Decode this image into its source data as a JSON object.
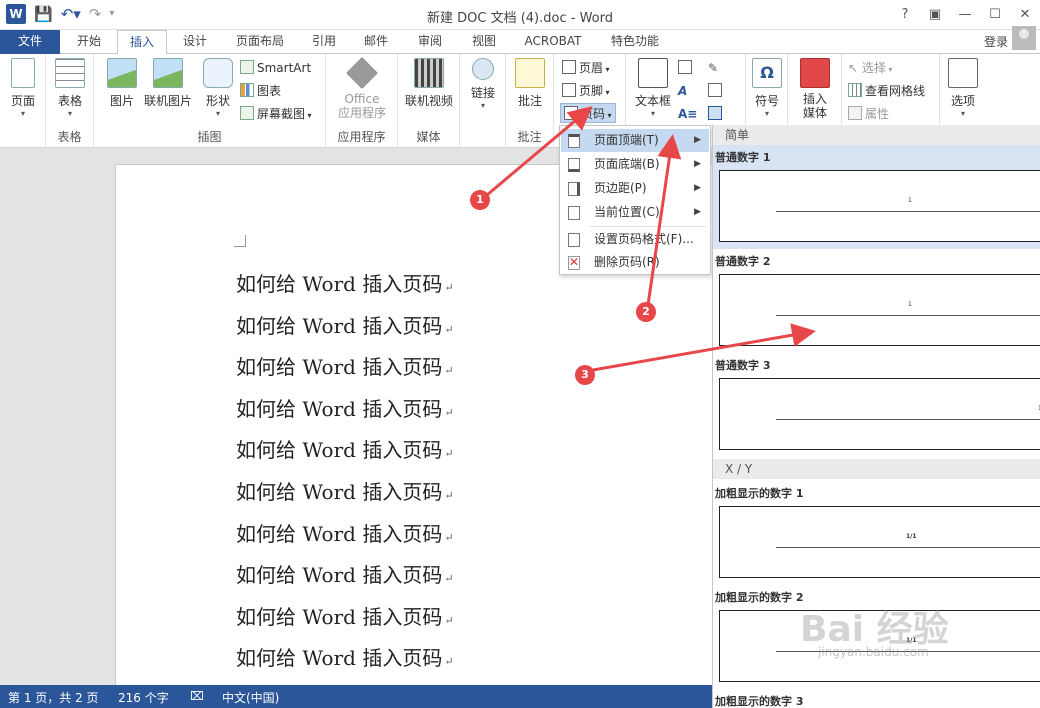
{
  "window": {
    "app_icon": "W",
    "title": "新建 DOC 文档 (4).doc - Word",
    "help": "?",
    "controls": [
      "▣",
      "—",
      "☐",
      "✕"
    ]
  },
  "tabs": {
    "file": "文件",
    "items": [
      "开始",
      "插入",
      "设计",
      "页面布局",
      "引用",
      "邮件",
      "审阅",
      "视图",
      "ACROBAT",
      "特色功能"
    ],
    "active": "插入",
    "login": "登录"
  },
  "ribbon": {
    "page": "页面",
    "table": "表格",
    "table_group": "表格",
    "picture": "图片",
    "online_picture": "联机图片",
    "shapes": "形状",
    "smartart": "SmartArt",
    "chart": "图表",
    "screenshot": "屏幕截图",
    "illustrations_group": "插图",
    "office_apps_1": "Office",
    "office_apps_2": "应用程序",
    "apps_group": "应用程序",
    "online_video": "联机视频",
    "media_group": "媒体",
    "link": "链接",
    "comment": "批注",
    "comment_group": "批注",
    "header": "页眉",
    "footer": "页脚",
    "page_number": "页码",
    "textbox": "文本框",
    "symbol": "符号",
    "insert_media_1": "插入",
    "insert_media_2": "媒体",
    "select": "选择",
    "view_gridlines": "查看网格线",
    "properties": "属性",
    "options": "选项"
  },
  "document": {
    "lines": [
      "如何给 Word 插入页码",
      "如何给 Word 插入页码",
      "如何给 Word 插入页码",
      "如何给 Word 插入页码",
      "如何给 Word 插入页码",
      "如何给 Word 插入页码",
      "如何给 Word 插入页码",
      "如何给 Word 插入页码",
      "如何给 Word 插入页码",
      "如何给 Word 插入页码"
    ],
    "paragraph_mark": "↵"
  },
  "page_number_menu": {
    "items": [
      "页面顶端(T)",
      "页面底端(B)",
      "页边距(P)",
      "当前位置(C)",
      "设置页码格式(F)...",
      "删除页码(R)"
    ]
  },
  "gallery": {
    "section_simple": "简单",
    "section_xy": "X / Y",
    "items": [
      "普通数字 1",
      "普通数字 2",
      "普通数字 3",
      "加粗显示的数字 1",
      "加粗显示的数字 2",
      "加粗显示的数字 3"
    ],
    "thumb_numbers": [
      "1",
      "1",
      "1",
      "1/1",
      "1/1"
    ]
  },
  "status_bar": {
    "page": "第 1 页，共 2 页",
    "words": "216 个字",
    "language": "中文(中国)"
  },
  "annotations": {
    "badges": [
      "1",
      "2",
      "3"
    ]
  },
  "watermark": {
    "brand": "Bai 经验",
    "url": "jingyan.baidu.com"
  },
  "colors": {
    "word_blue": "#2b579a",
    "annotation_red": "#e8474a",
    "menu_highlight": "#c5d9f1"
  }
}
